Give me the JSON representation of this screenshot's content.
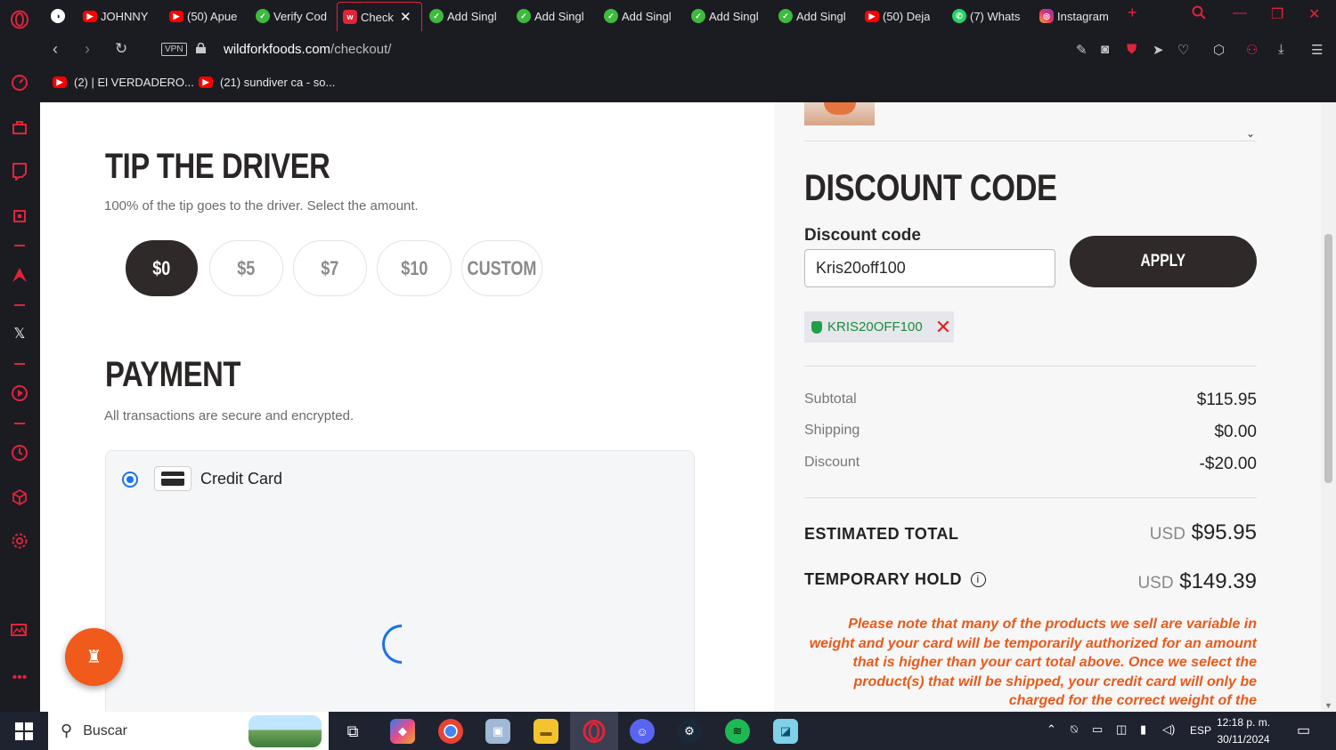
{
  "browser": {
    "tabs": [
      {
        "label": "JOHNNY",
        "icon": "youtube-icon"
      },
      {
        "label": "(50) Apue",
        "icon": "youtube-icon"
      },
      {
        "label": "Verify Cod",
        "icon": "green-check-icon"
      },
      {
        "label": "Check",
        "icon": "wildfork-icon",
        "active": true
      },
      {
        "label": "Add Singl",
        "icon": "green-check-icon"
      },
      {
        "label": "Add Singl",
        "icon": "green-check-icon"
      },
      {
        "label": "Add Singl",
        "icon": "green-check-icon"
      },
      {
        "label": "Add Singl",
        "icon": "green-check-icon"
      },
      {
        "label": "Add Singl",
        "icon": "green-check-icon"
      },
      {
        "label": "(50) Deja",
        "icon": "youtube-icon"
      },
      {
        "label": "(7) Whats",
        "icon": "whatsapp-icon"
      },
      {
        "label": "Instagram",
        "icon": "instagram-icon"
      }
    ],
    "address": {
      "vpn": "VPN",
      "domain": "wildforkfoods.com",
      "path": "/checkout/"
    },
    "bookmarks": [
      {
        "label": "(2) | El VERDADERO...",
        "icon": "youtube-icon"
      },
      {
        "label": "(21) sundiver ca - so...",
        "icon": "youtube-icon"
      }
    ],
    "accent": "#e0243a"
  },
  "tip": {
    "heading": "TIP THE DRIVER",
    "subtitle": "100% of the tip goes to the driver. Select the amount.",
    "options": [
      "$0",
      "$5",
      "$7",
      "$10",
      "CUSTOM"
    ],
    "selected": "$0"
  },
  "payment": {
    "heading": "PAYMENT",
    "subtitle": "All transactions are secure and encrypted.",
    "method_label": "Credit Card"
  },
  "discount": {
    "heading": "DISCOUNT CODE",
    "field_label": "Discount code",
    "field_value": "Kris20off100",
    "apply_label": "APPLY",
    "applied_code": "KRIS20OFF100"
  },
  "summary": {
    "rows": [
      {
        "label": "Subtotal",
        "value": "$115.95"
      },
      {
        "label": "Shipping",
        "value": "$0.00"
      },
      {
        "label": "Discount",
        "value": "-$20.00"
      }
    ],
    "estimated_total": {
      "label": "ESTIMATED TOTAL",
      "currency": "USD",
      "value": "$95.95"
    },
    "temporary_hold": {
      "label": "TEMPORARY HOLD",
      "currency": "USD",
      "value": "$149.39"
    },
    "note": "Please note that many of the products we sell are variable in weight and your card will be temporarily authorized for an amount that is higher than your cart total above. Once we select the product(s) that will be shipped, your credit card will only be charged for the correct weight of the"
  },
  "taskbar": {
    "search_placeholder": "Buscar",
    "language": "ESP",
    "time": "12:18 p. m.",
    "date": "30/11/2024"
  }
}
